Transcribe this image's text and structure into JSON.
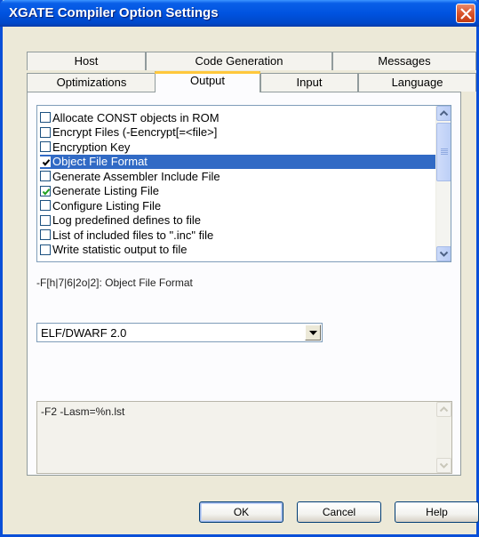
{
  "window": {
    "title": "XGATE Compiler Option Settings"
  },
  "tabs_back": [
    {
      "label": "Host"
    },
    {
      "label": "Code Generation"
    },
    {
      "label": "Messages"
    }
  ],
  "tabs_front": [
    {
      "label": "Optimizations"
    },
    {
      "label": "Output",
      "active": true
    },
    {
      "label": "Input"
    },
    {
      "label": "Language"
    }
  ],
  "options": [
    {
      "label": "Allocate CONST objects in ROM",
      "checked": false
    },
    {
      "label": "Encrypt Files (-Eencrypt[=<file>]",
      "checked": false
    },
    {
      "label": "Encryption Key",
      "checked": false
    },
    {
      "label": "Object File Format",
      "checked": true,
      "selected": true
    },
    {
      "label": "Generate Assembler Include File",
      "checked": false
    },
    {
      "label": "Generate Listing File",
      "checked": true
    },
    {
      "label": "Configure Listing File",
      "checked": false
    },
    {
      "label": "Log predefined defines to file",
      "checked": false
    },
    {
      "label": "List of included files to \".inc\" file",
      "checked": false
    },
    {
      "label": "Write statistic output to file",
      "checked": false
    }
  ],
  "description": "-F[h|7|6|2o|2]: Object File Format",
  "format_select": {
    "value": "ELF/DWARF 2.0"
  },
  "command_line": "-F2 -Lasm=%n.lst",
  "buttons": {
    "ok": "OK",
    "cancel": "Cancel",
    "help": "Help"
  },
  "colors": {
    "title_bar": "#0053e0",
    "selection": "#316ac5",
    "active_tab_accent": "#ffc83c",
    "close_button": "#d9532a"
  }
}
